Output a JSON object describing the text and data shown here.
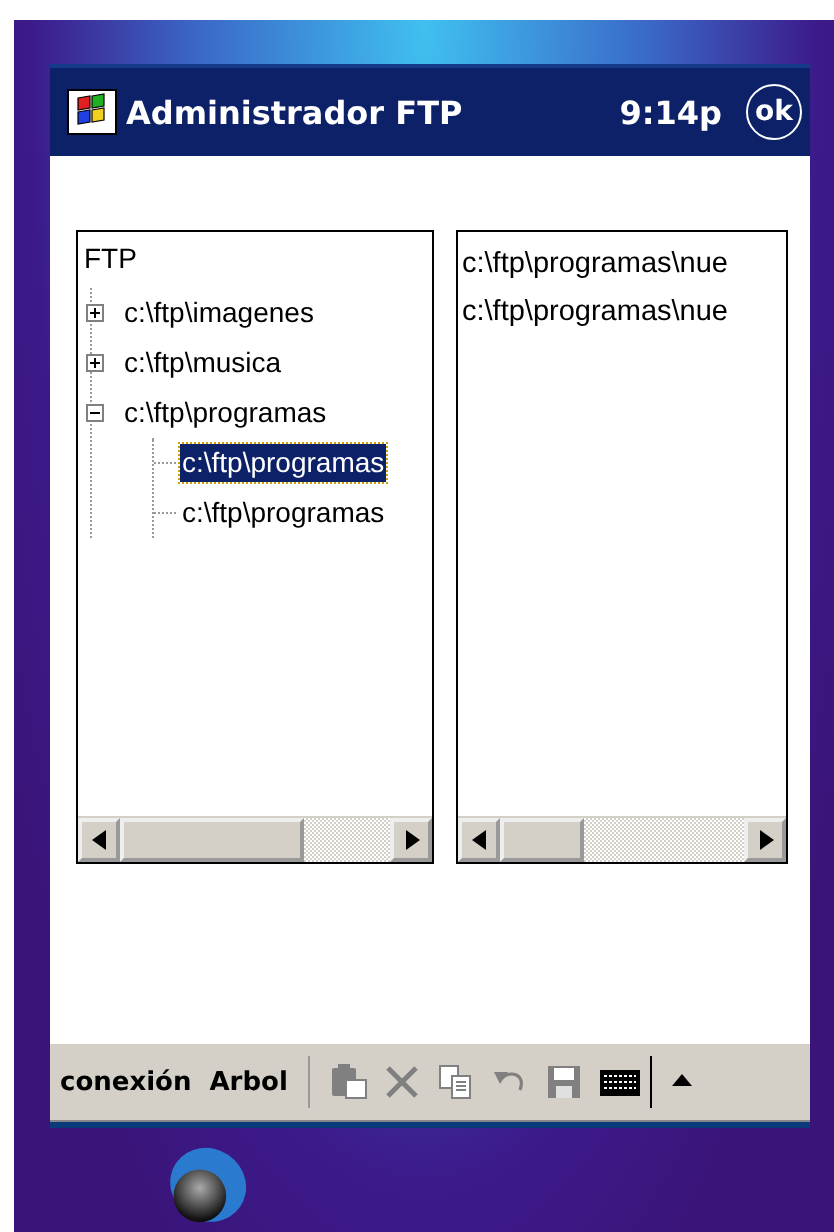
{
  "title_bar": {
    "title": "Administrador FTP",
    "time": "9:14p",
    "ok_label": "ok"
  },
  "tree": {
    "label": "FTP",
    "children": [
      {
        "label": "c:\\ftp\\imagenes",
        "expanded": false,
        "selected": false
      },
      {
        "label": "c:\\ftp\\musica",
        "expanded": false,
        "selected": false
      },
      {
        "label": "c:\\ftp\\programas",
        "expanded": true,
        "selected": false,
        "children": [
          {
            "label": "c:\\ftp\\programas",
            "selected": true
          },
          {
            "label": "c:\\ftp\\programas",
            "selected": false
          }
        ]
      }
    ]
  },
  "file_list": [
    {
      "label": "c:\\ftp\\programas\\nue"
    },
    {
      "label": "c:\\ftp\\programas\\nue"
    }
  ],
  "menu_bar": {
    "menus": [
      "conexión",
      "Arbol"
    ],
    "tools": [
      {
        "kind": "paste",
        "disabled": true
      },
      {
        "kind": "delete",
        "disabled": true
      },
      {
        "kind": "copy",
        "disabled": true
      },
      {
        "kind": "undo",
        "disabled": true
      },
      {
        "kind": "save",
        "disabled": true
      },
      {
        "kind": "keyboard",
        "disabled": false
      },
      {
        "kind": "arrow",
        "disabled": false
      }
    ]
  }
}
